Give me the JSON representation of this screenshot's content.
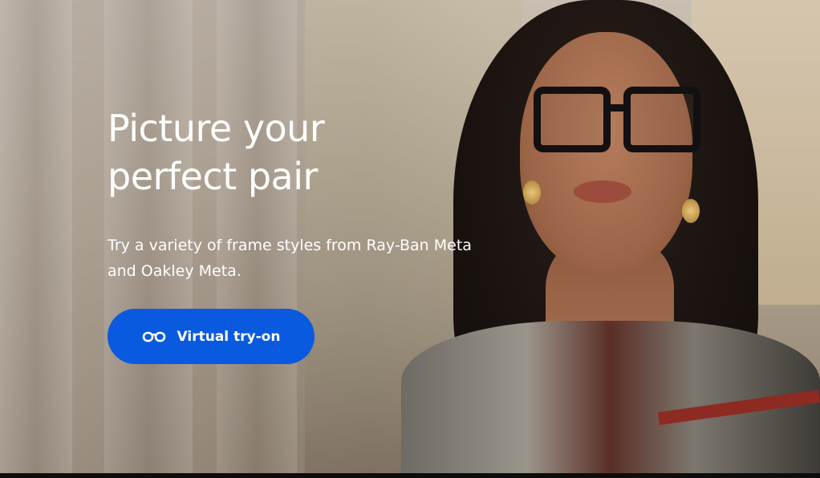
{
  "hero": {
    "headline": "Picture your perfect pair",
    "subtext": "Try a variety of frame styles from Ray-Ban Meta and Oakley Meta.",
    "cta": {
      "label": "Virtual try-on",
      "icon": "glasses-icon",
      "color": "#0a5ae0"
    },
    "image": "woman-wearing-black-glasses"
  }
}
